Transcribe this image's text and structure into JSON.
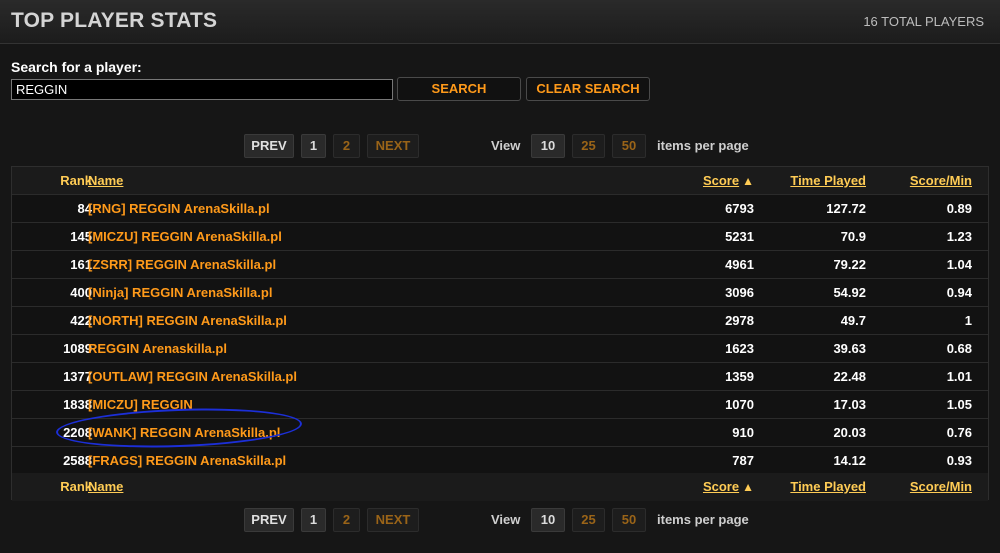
{
  "header": {
    "title": "TOP PLAYER STATS",
    "total_players": "16 TOTAL PLAYERS"
  },
  "search": {
    "label": "Search for a player:",
    "value": "REGGIN",
    "search_label": "SEARCH",
    "clear_label": "CLEAR SEARCH"
  },
  "pagination": {
    "prev": "PREV",
    "pages": [
      "1",
      "2"
    ],
    "next": "NEXT",
    "view_label": "View",
    "per_page_options": [
      "10",
      "25",
      "50"
    ],
    "per_page_suffix": "items per page"
  },
  "table": {
    "columns": {
      "rank": "Rank",
      "name": "Name",
      "score": "Score",
      "time_played": "Time Played",
      "score_per_min": "Score/Min"
    },
    "sort_icon": "sort-ascending-icon",
    "rows": [
      {
        "rank": "84",
        "name": "[RNG] REGGIN ArenaSkilla.pl",
        "score": "6793",
        "time": "127.72",
        "spm": "0.89"
      },
      {
        "rank": "145",
        "name": "[MICZU] REGGIN ArenaSkilla.pl",
        "score": "5231",
        "time": "70.9",
        "spm": "1.23"
      },
      {
        "rank": "161",
        "name": "[ZSRR] REGGIN ArenaSkilla.pl",
        "score": "4961",
        "time": "79.22",
        "spm": "1.04"
      },
      {
        "rank": "400",
        "name": "[Ninja] REGGIN ArenaSkilla.pl",
        "score": "3096",
        "time": "54.92",
        "spm": "0.94"
      },
      {
        "rank": "422",
        "name": "[NORTH] REGGIN ArenaSkilla.pl",
        "score": "2978",
        "time": "49.7",
        "spm": "1"
      },
      {
        "rank": "1089",
        "name": "REGGIN Arenaskilla.pl",
        "score": "1623",
        "time": "39.63",
        "spm": "0.68"
      },
      {
        "rank": "1377",
        "name": "[OUTLAW] REGGIN ArenaSkilla.pl",
        "score": "1359",
        "time": "22.48",
        "spm": "1.01"
      },
      {
        "rank": "1838",
        "name": "[MICZU] REGGIN",
        "score": "1070",
        "time": "17.03",
        "spm": "1.05"
      },
      {
        "rank": "2208",
        "name": "[WANK] REGGIN ArenaSkilla.pl",
        "score": "910",
        "time": "20.03",
        "spm": "0.76"
      },
      {
        "rank": "2588",
        "name": "[FRAGS] REGGIN ArenaSkilla.pl",
        "score": "787",
        "time": "14.12",
        "spm": "0.93"
      }
    ]
  },
  "colors": {
    "accent": "#ff9a1a",
    "header_link": "#ffcc55",
    "annotation": "#1c2fd8"
  }
}
